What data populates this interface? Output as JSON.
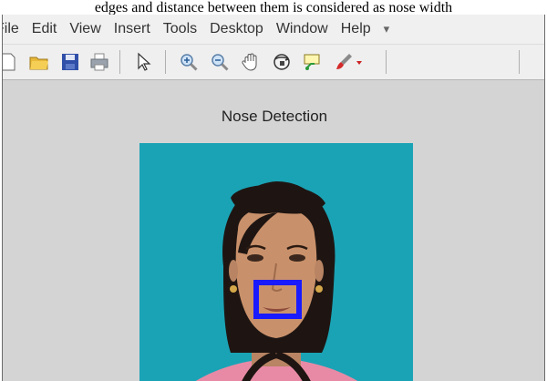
{
  "caption_text": "edges and distance between them is considered as nose width",
  "menubar": {
    "items": [
      "File",
      "Edit",
      "View",
      "Insert",
      "Tools",
      "Desktop",
      "Window",
      "Help"
    ],
    "overflow_glyph": "▾"
  },
  "toolbar": {
    "icons": [
      "new-figure-icon",
      "open-file-icon",
      "save-icon",
      "print-icon",
      "pointer-icon",
      "zoom-in-icon",
      "zoom-out-icon",
      "pan-icon",
      "rotate-3d-icon",
      "data-cursor-icon",
      "brush-icon"
    ]
  },
  "figure": {
    "title": "Nose Detection",
    "background_color": "#1aa3b5",
    "detection_box_color": "#1a1aff"
  }
}
